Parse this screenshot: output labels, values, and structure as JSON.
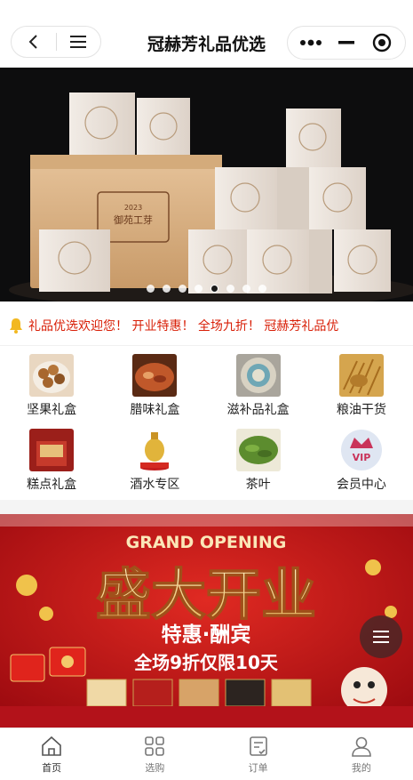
{
  "header": {
    "title": "冠赫芳礼品优选",
    "back_icon": "back-arrow-icon",
    "menu_icon": "hamburger-icon",
    "more_icon": "more-dots-icon",
    "minimize_icon": "minimize-icon",
    "close_icon": "target-close-icon"
  },
  "banner": {
    "box_label": "御苑工芽",
    "box_year": "2023",
    "slide_count": 8,
    "active_slide": 5
  },
  "notice": {
    "icon": "bell-icon",
    "text": "礼品优选欢迎您！ 开业特惠！ 全场九折！          冠赫芳礼品优"
  },
  "categories": [
    {
      "label": "坚果礼盒",
      "icon": "nuts-image"
    },
    {
      "label": "腊味礼盒",
      "icon": "cured-meat-image"
    },
    {
      "label": "滋补品礼盒",
      "icon": "tonic-image"
    },
    {
      "label": "粮油干货",
      "icon": "grain-image"
    },
    {
      "label": "糕点礼盒",
      "icon": "pastry-image"
    },
    {
      "label": "酒水专区",
      "icon": "liquor-image"
    },
    {
      "label": "茶叶",
      "icon": "tea-image"
    },
    {
      "label": "会员中心",
      "icon": "vip-crown-image"
    }
  ],
  "promo": {
    "grand_opening": "GRAND OPENING",
    "headline": "盛大开业",
    "subline": "特惠·酬宾",
    "offer": "全场9折仅限10天",
    "vip_badge": "VIP"
  },
  "float_menu_icon": "hamburger-icon",
  "tabs": [
    {
      "label": "首页",
      "icon": "home-icon",
      "active": true
    },
    {
      "label": "选购",
      "icon": "grid-icon",
      "active": false
    },
    {
      "label": "订单",
      "icon": "order-icon",
      "active": false
    },
    {
      "label": "我的",
      "icon": "user-icon",
      "active": false
    }
  ],
  "colors": {
    "accent_red": "#d81e06",
    "promo_red": "#c8101a",
    "gold": "#f3c96b"
  }
}
